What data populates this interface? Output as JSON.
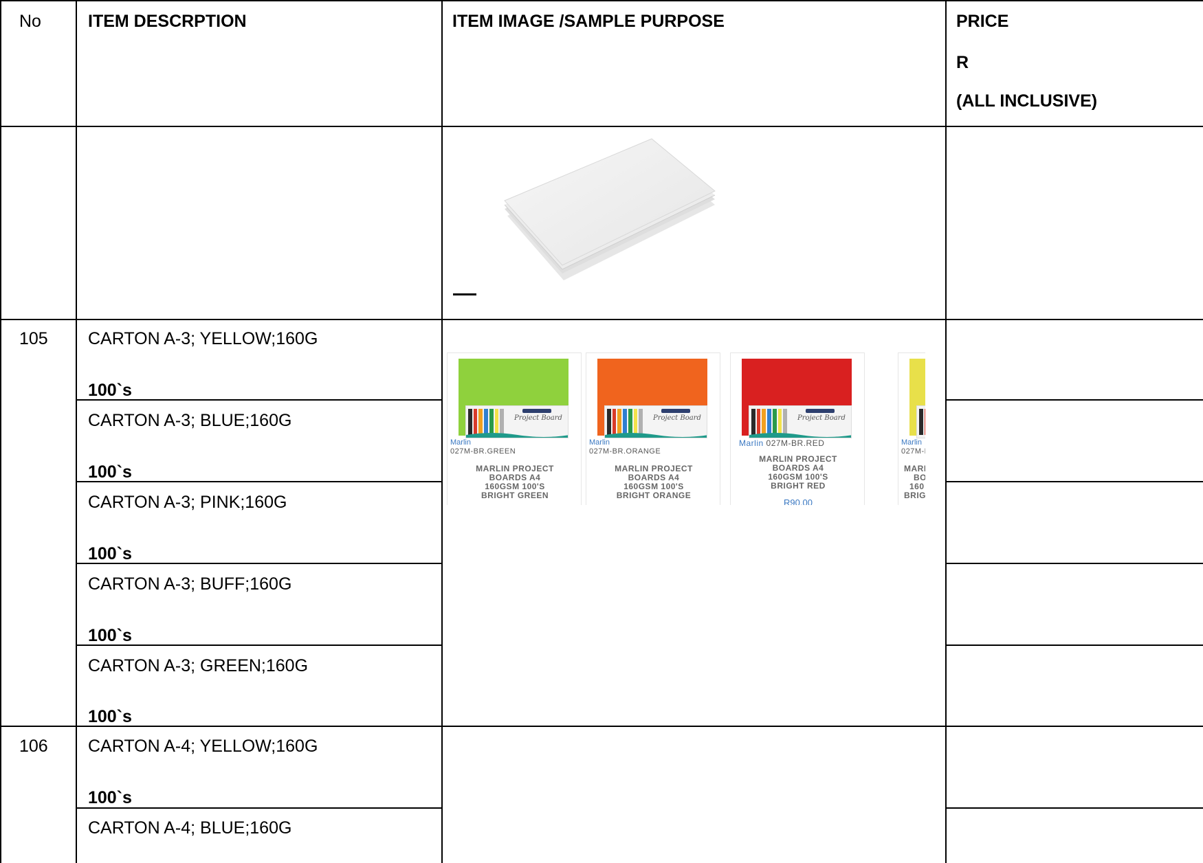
{
  "headers": {
    "no": "No",
    "description": "ITEM DESCRPTION",
    "image": "ITEM IMAGE /SAMPLE PURPOSE",
    "price_line1": "PRICE",
    "price_line2": "R",
    "price_line3": "(ALL INCLUSIVE)"
  },
  "items": [
    {
      "no": "105",
      "desc": "CARTON A-3; YELLOW;160G",
      "qty": "100`s"
    },
    {
      "no": "",
      "desc": "CARTON A-3; BLUE;160G",
      "qty": "100`s"
    },
    {
      "no": "",
      "desc": "CARTON A-3; PINK;160G",
      "qty": "100`s"
    },
    {
      "no": "",
      "desc": "CARTON A-3; BUFF;160G",
      "qty": "100`s"
    },
    {
      "no": "",
      "desc": "CARTON A-3; GREEN;160G",
      "qty": "100`s"
    },
    {
      "no": "106",
      "desc": "CARTON A-4; YELLOW;160G",
      "qty": "100`s"
    },
    {
      "no": "",
      "desc": "CARTON A-4; BLUE;160G",
      "qty": ""
    }
  ],
  "product_cards": [
    {
      "brand": "Marlin",
      "code": "027M-BR.GREEN",
      "name_lines": [
        "MARLIN PROJECT",
        "BOARDS A4",
        "160GSM 100'S",
        "BRIGHT GREEN"
      ],
      "price": "",
      "color": "#8fd13d",
      "pack_text": "Project Board"
    },
    {
      "brand": "Marlin",
      "code": "027M-BR.ORANGE",
      "name_lines": [
        "MARLIN PROJECT",
        "BOARDS A4",
        "160GSM 100'S",
        "BRIGHT ORANGE"
      ],
      "price": "",
      "color": "#f0641e",
      "pack_text": "Project Board"
    },
    {
      "brand": "Marlin",
      "code": "027M-BR.RED",
      "name_lines": [
        "MARLIN PROJECT",
        "BOARDS A4",
        "160GSM 100'S",
        "BRIGHT RED"
      ],
      "price": "R90.00",
      "color": "#d92020",
      "pack_text": "Project Board"
    },
    {
      "brand": "Marlin",
      "code": "027M-B",
      "name_lines": [
        "MARL",
        "BO",
        "160",
        "BRIG"
      ],
      "price": "",
      "color": "#e8e04a",
      "pack_text": ""
    }
  ],
  "stripe_colors": [
    "#2a2a2a",
    "#d93a2a",
    "#f0a020",
    "#2f7fd0",
    "#2a9a4a",
    "#f2e24a",
    "#b0b0b0"
  ],
  "wave_color": "#1f9a8a"
}
